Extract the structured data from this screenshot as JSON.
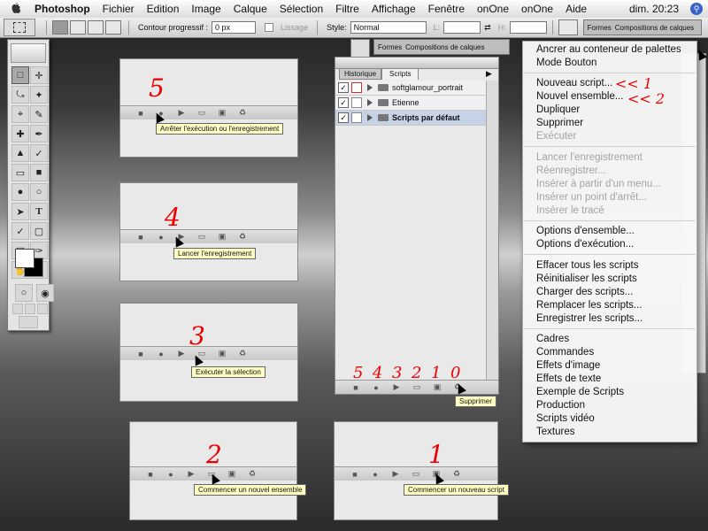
{
  "menubar": {
    "items": [
      "Photoshop",
      "Fichier",
      "Edition",
      "Image",
      "Calque",
      "Sélection",
      "Filtre",
      "Affichage",
      "Fenêtre",
      "onOne",
      "onOne",
      "Aide"
    ],
    "clock": "dim. 20:23"
  },
  "optionsbar": {
    "contour_label": "Contour progressif :",
    "contour_value": "0 px",
    "lissage_label": "Lissage",
    "style_label": "Style:",
    "style_value": "Normal",
    "l_label": "L:",
    "h_label": "H:",
    "well_tabs": [
      "Formes",
      "Compositions de calques"
    ]
  },
  "panel_well": {
    "tabs": [
      "Formes",
      "Compositions de calques"
    ]
  },
  "steps": [
    {
      "num": "5",
      "tip": "Arrêter l'exécution ou l'enregistrement"
    },
    {
      "num": "4",
      "tip": "Lancer l'enregistrement"
    },
    {
      "num": "3",
      "tip": "Exécuter la sélection"
    },
    {
      "num": "2",
      "tip": "Commencer un nouvel ensemble"
    },
    {
      "num": "1",
      "tip": "Commencer un nouveau script"
    }
  ],
  "scripts_panel": {
    "tabs": [
      "Historique",
      "Scripts"
    ],
    "rows": [
      "softglamour_portrait",
      "Etienne",
      "Scripts par défaut"
    ],
    "button_numbers": [
      "5",
      "4",
      "3",
      "2",
      "1",
      "0"
    ],
    "tip": "Supprimer"
  },
  "menu": {
    "items": [
      {
        "label": "Ancrer au conteneur de palettes",
        "enabled": true
      },
      {
        "label": "Mode Bouton",
        "enabled": true
      },
      {
        "label": "Nouveau script...",
        "enabled": true
      },
      {
        "label": "Nouvel ensemble...",
        "enabled": true
      },
      {
        "label": "Dupliquer",
        "enabled": true
      },
      {
        "label": "Supprimer",
        "enabled": true
      },
      {
        "label": "Exécuter",
        "enabled": false
      },
      {
        "label": "Lancer l'enregistrement",
        "enabled": false
      },
      {
        "label": "Réenregistrer...",
        "enabled": false
      },
      {
        "label": "Insérer à partir d'un menu...",
        "enabled": false
      },
      {
        "label": "Insérer un point d'arrêt...",
        "enabled": false
      },
      {
        "label": "Insérer le tracé",
        "enabled": false
      },
      {
        "label": "Options d'ensemble...",
        "enabled": true
      },
      {
        "label": "Options d'exécution...",
        "enabled": true
      },
      {
        "label": "Effacer tous les scripts",
        "enabled": true
      },
      {
        "label": "Réinitialiser les scripts",
        "enabled": true
      },
      {
        "label": "Charger des scripts...",
        "enabled": true
      },
      {
        "label": "Remplacer les scripts...",
        "enabled": true
      },
      {
        "label": "Enregistrer les scripts...",
        "enabled": true
      },
      {
        "label": "Cadres",
        "enabled": true
      },
      {
        "label": "Commandes",
        "enabled": true
      },
      {
        "label": "Effets d'image",
        "enabled": true
      },
      {
        "label": "Effets de texte",
        "enabled": true
      },
      {
        "label": "Exemple de Scripts",
        "enabled": true
      },
      {
        "label": "Production",
        "enabled": true
      },
      {
        "label": "Scripts vidéo",
        "enabled": true
      },
      {
        "label": "Textures",
        "enabled": true
      }
    ],
    "annotations": [
      "<< 1",
      "<< 2"
    ]
  },
  "colors": {
    "annotation": "#ee0000",
    "tooltip": "#ffffc4"
  }
}
